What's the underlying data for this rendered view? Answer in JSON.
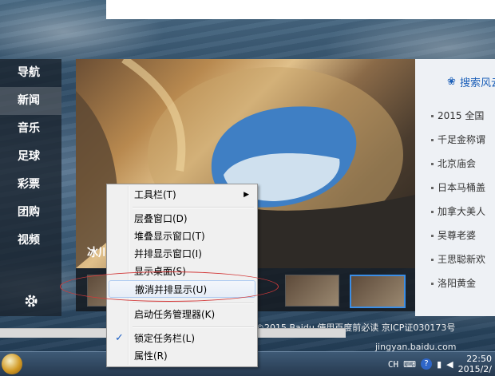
{
  "nav": {
    "items": [
      "导航",
      "新闻",
      "音乐",
      "足球",
      "彩票",
      "团购",
      "视频"
    ],
    "active_index": 1,
    "settings_icon": "gear-icon"
  },
  "photo": {
    "caption": "冰川"
  },
  "news": {
    "header": "搜索风云榜",
    "items": [
      "2015 全国",
      "千足金称谓",
      "北京庙会",
      "日本马桶盖",
      "加拿大美人",
      "吴尊老婆",
      "王思聪新欢",
      "洛阳黄金"
    ]
  },
  "footer": {
    "text": "©2015 Baidu 使用百度前必读 京ICP证030173号"
  },
  "context_menu": {
    "items": [
      {
        "label": "工具栏(T)",
        "submenu": true
      },
      {
        "label": "层叠窗口(D)"
      },
      {
        "label": "堆叠显示窗口(T)"
      },
      {
        "label": "并排显示窗口(I)"
      },
      {
        "label": "显示桌面(S)"
      },
      {
        "label": "撤消并排显示(U)",
        "highlighted": true
      },
      {
        "label": "启动任务管理器(K)"
      },
      {
        "label": "锁定任务栏(L)",
        "checked": true
      },
      {
        "label": "属性(R)"
      }
    ]
  },
  "taskbar": {
    "lang": "CH",
    "time": "22:50",
    "date": "2015/2/"
  },
  "watermark": "jingyan.baidu.com",
  "colors": {
    "accent": "#1b5fb8",
    "annotation": "#d23a3a"
  }
}
